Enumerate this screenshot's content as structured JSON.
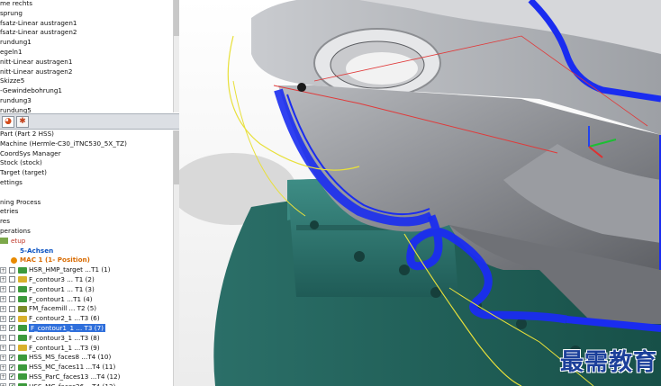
{
  "feature_tree": {
    "items": [
      "me rechts",
      "sprung",
      "fsatz-Linear austragen1",
      "fsatz-Linear austragen2",
      "rundung1",
      "egeln1",
      "nitt-Linear austragen1",
      "nitt-Linear austragen2",
      "Skizze5",
      "-Gewindebohrung1",
      "rundung3",
      "rundung5"
    ]
  },
  "panel_tabs": [
    {
      "icon": "cam-tab-icon"
    },
    {
      "icon": "star-tab-icon"
    }
  ],
  "cam_tree": {
    "items": [
      {
        "text": "Part (Part 2 HSS)"
      },
      {
        "text": "Machine (Hermle-C30_iTNC530_5X_TZ)"
      },
      {
        "text": "CoordSys Manager"
      },
      {
        "text": "Stock (stock)"
      },
      {
        "text": "Target (target)"
      },
      {
        "text": "ettings"
      },
      {
        "text": ""
      },
      {
        "text": "ning Process"
      },
      {
        "text": "etries"
      },
      {
        "text": "res"
      },
      {
        "text": "perations"
      }
    ],
    "setup_label": "etup",
    "axis_label": "5-Achsen",
    "mac_label": "MAC 1 (1- Position)",
    "operations": [
      {
        "label": "HSR_HMP_target ...T1 (1)",
        "checked": false,
        "icon": "green"
      },
      {
        "label": "F_contour3 ... T1 (2)",
        "checked": false,
        "icon": "yellow"
      },
      {
        "label": "F_contour1 ... T1 (3)",
        "checked": false,
        "icon": "green"
      },
      {
        "label": "F_contour1 ...T1 (4)",
        "checked": false,
        "icon": "green"
      },
      {
        "label": "FM_facemill ... T2 (5)",
        "checked": false,
        "icon": "olive"
      },
      {
        "label": "F_contour2_1 ...T3 (6)",
        "checked": true,
        "icon": "yellow"
      },
      {
        "label": "F_contour1_1 ... T3 (7)",
        "checked": true,
        "icon": "green",
        "selected": true
      },
      {
        "label": "F_contour3_1 ...T3 (8)",
        "checked": false,
        "icon": "green"
      },
      {
        "label": "F_contour1_1 ...T3 (9)",
        "checked": false,
        "icon": "yellow"
      },
      {
        "label": "HSS_MS_faces8 ...T4 (10)",
        "checked": true,
        "icon": "green"
      },
      {
        "label": "HSS_MC_faces11 ...T4 (11)",
        "checked": true,
        "icon": "green"
      },
      {
        "label": "HSS_ParC_faces13 ...T4 (12)",
        "checked": true,
        "icon": "green"
      },
      {
        "label": "HSS_MC_faces26 ...T4 (13)",
        "checked": true,
        "icon": "green"
      }
    ]
  },
  "watermark": {
    "text": "最需教育"
  },
  "colors": {
    "toolpath_blue": "#1a2cf0",
    "path_yellow": "#e8e03a",
    "fixture_green": "#2f7a72",
    "part_gray": "#8d8f94",
    "selection": "#2f6fdb"
  }
}
